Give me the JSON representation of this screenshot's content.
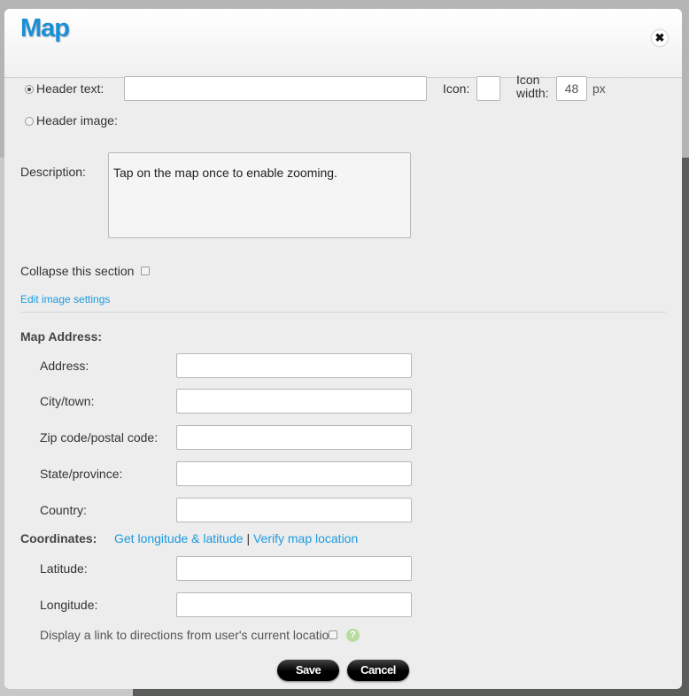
{
  "dialog": {
    "title": "Map",
    "close_icon": "close-icon"
  },
  "header": {
    "text_label": "Header text:",
    "text_value": "",
    "icon_label": "Icon:",
    "icon_width_label_1": "Icon",
    "icon_width_label_2": "width:",
    "icon_width_value": "48",
    "unit": "px",
    "image_label": "Header image:",
    "selected": "Header text"
  },
  "description": {
    "label": "Description:",
    "value": "Tap on the map once to enable zooming."
  },
  "collapse": {
    "label": "Collapse this section",
    "checked": false
  },
  "edit_image_link": "Edit image settings",
  "address": {
    "heading": "Map Address:",
    "fields": [
      {
        "label": "Address:",
        "value": ""
      },
      {
        "label": "City/town:",
        "value": ""
      },
      {
        "label": "Zip code/postal code:",
        "value": ""
      },
      {
        "label": "State/province:",
        "value": ""
      },
      {
        "label": "Country:",
        "value": ""
      }
    ]
  },
  "coordinates": {
    "heading": "Coordinates:",
    "get_link": "Get longitude & latitude",
    "separator": "|",
    "verify_link": "Verify map location",
    "latitude_label": "Latitude:",
    "latitude_value": "",
    "longitude_label": "Longitude:",
    "longitude_value": ""
  },
  "directions": {
    "label": "Display a link to directions from user's current location",
    "checked": false,
    "help_icon": "help-icon"
  },
  "buttons": {
    "save": "Save",
    "cancel": "Cancel"
  }
}
